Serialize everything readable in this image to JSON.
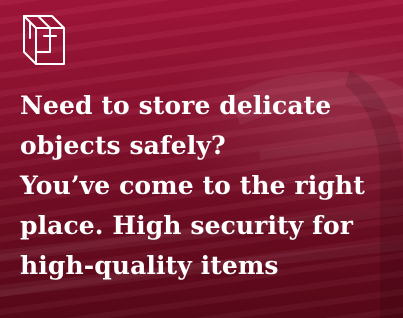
{
  "banner": {
    "icon": "box-package-icon",
    "headline_lines": [
      "Need to store delicate",
      "objects safely?",
      "You’ve come to the right",
      "place. High security for",
      "high-quality items"
    ],
    "colors": {
      "background": "#8c1230",
      "text": "#ffffff",
      "icon": "#ffffff"
    }
  }
}
